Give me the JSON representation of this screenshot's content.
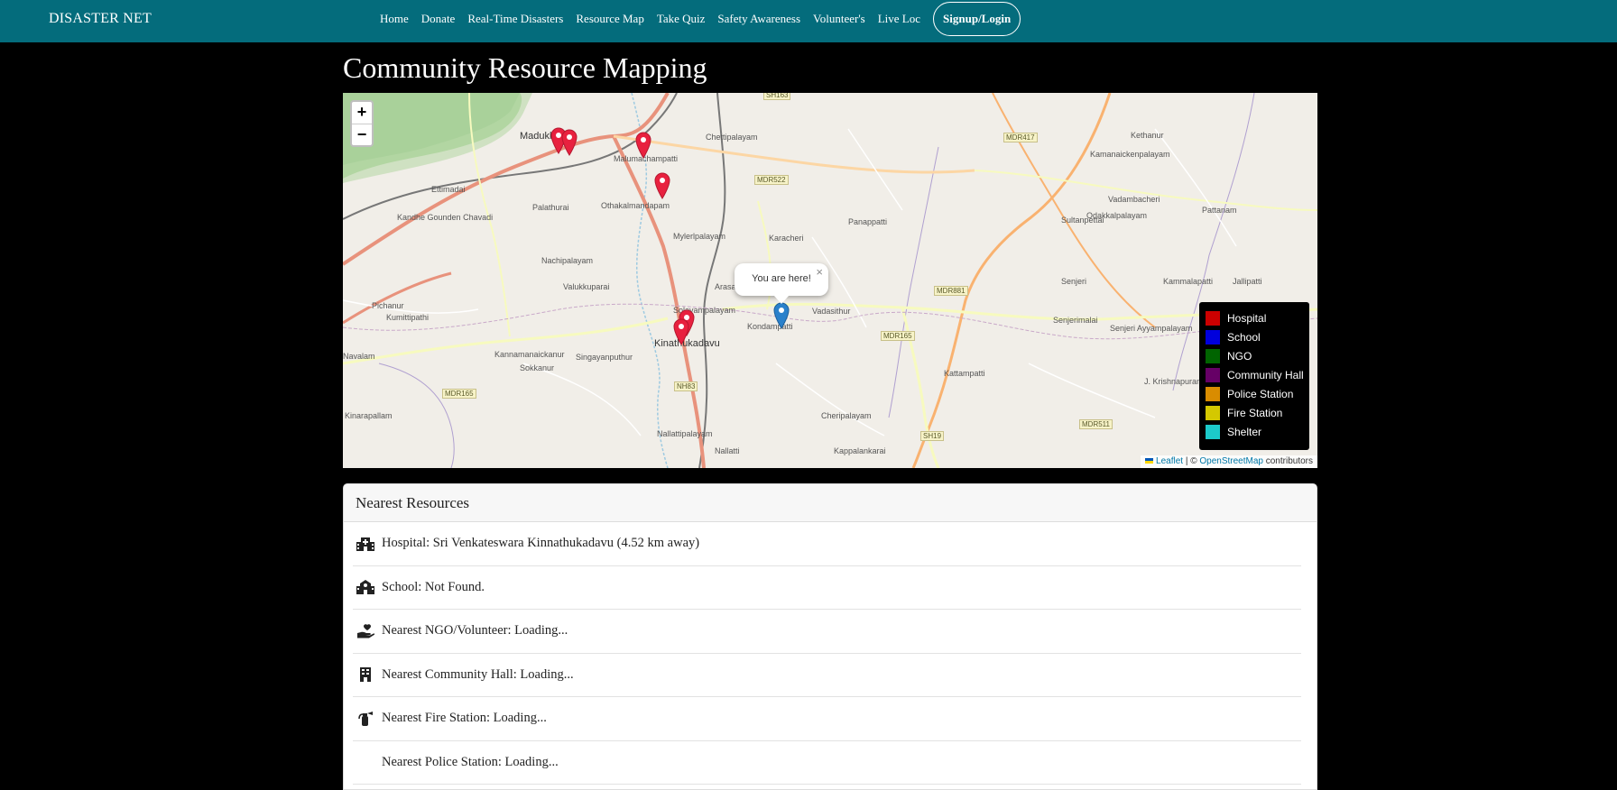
{
  "navbar": {
    "brand": "DISASTER NET",
    "links": [
      "Home",
      "Donate",
      "Real-Time Disasters",
      "Resource Map",
      "Take Quiz",
      "Safety Awareness",
      "Volunteer's",
      "Live Loc"
    ],
    "cta": "Signup/Login",
    "bg_color": "#046c7c"
  },
  "page": {
    "title": "Community Resource Mapping"
  },
  "map": {
    "zoom_in": "+",
    "zoom_out": "−",
    "popup": {
      "text": "You are here!",
      "close": "×"
    },
    "places": [
      "Madukkarai",
      "Malumachampatti",
      "Chettipalayam",
      "Ettimadai",
      "Palathurai",
      "Othakalmandapam",
      "Kandhe Gounden Chavadi",
      "Mylerlpalayam",
      "Nachipalayam",
      "Valukkuparai",
      "Solavampalayam",
      "Kinathukadavu",
      "Kondampatti",
      "Vadasithur",
      "Panappatti",
      "Karacheri",
      "Pichanur",
      "Kumittipathi",
      "Kannamanaickanur",
      "Singayanputhur",
      "Sokkanur",
      "Nallattipalayam",
      "Cheripalayam",
      "Kappalankarai",
      "Kattampatti",
      "Kinarapallam",
      "Kethanur",
      "Kamanaickenpalayam",
      "Vadambacheri",
      "Odakkalpalayam",
      "Sultanpettai",
      "Senjeri",
      "Kammalapatti",
      "Jallipatti",
      "Senjerimalai",
      "Senjeri Ayyampalayam",
      "J. Krishnapuram",
      "Arasapalayam",
      "Navalam",
      "Pattanam",
      "Nallatti"
    ],
    "road_shields": [
      "SH163",
      "MDR417",
      "MDR522",
      "MDR881",
      "MDR165",
      "NH83",
      "SH19",
      "MDR511",
      "MDR165"
    ],
    "legend": [
      {
        "label": "Hospital",
        "color": "#cc0000"
      },
      {
        "label": "School",
        "color": "#0000dd"
      },
      {
        "label": "NGO",
        "color": "#006400"
      },
      {
        "label": "Community Hall",
        "color": "#660066"
      },
      {
        "label": "Police Station",
        "color": "#d98c00"
      },
      {
        "label": "Fire Station",
        "color": "#d4c800"
      },
      {
        "label": "Shelter",
        "color": "#1ccaca"
      }
    ],
    "attribution": {
      "leaflet": "Leaflet",
      "separator": " | © ",
      "osm": "OpenStreetMap",
      "suffix": " contributors"
    },
    "marker_colors": {
      "resource": "#e8213f",
      "user": "#2a81cb"
    }
  },
  "resources": {
    "header": "Nearest Resources",
    "items": [
      {
        "icon": "hospital-icon",
        "text": "Hospital: Sri Venkateswara Kinnathukadavu (4.52 km away)"
      },
      {
        "icon": "school-icon",
        "text": "School: Not Found."
      },
      {
        "icon": "hand-holding-heart-icon",
        "text": "Nearest NGO/Volunteer: Loading..."
      },
      {
        "icon": "building-icon",
        "text": "Nearest Community Hall: Loading..."
      },
      {
        "icon": "fire-extinguisher-icon",
        "text": "Nearest Fire Station: Loading..."
      },
      {
        "icon": "police-icon",
        "text": "Nearest Police Station: Loading..."
      }
    ]
  }
}
